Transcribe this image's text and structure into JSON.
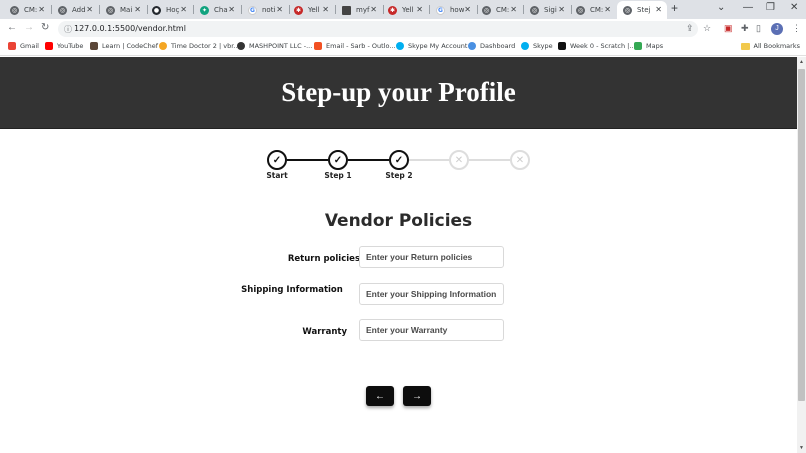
{
  "browser": {
    "tabs": [
      {
        "title": "CM:",
        "icon": "globe-icon"
      },
      {
        "title": "Add",
        "icon": "globe-icon"
      },
      {
        "title": "Mai",
        "icon": "globe-icon"
      },
      {
        "title": "Hoç",
        "icon": "github-icon"
      },
      {
        "title": "Cha",
        "icon": "chatgpt-icon"
      },
      {
        "title": "noti",
        "icon": "google-icon"
      },
      {
        "title": "Yell",
        "icon": "yelp-icon"
      },
      {
        "title": "myf",
        "icon": "page-icon"
      },
      {
        "title": "Yell",
        "icon": "yelp-icon"
      },
      {
        "title": "how",
        "icon": "google-icon"
      },
      {
        "title": "CM:",
        "icon": "globe-icon"
      },
      {
        "title": "Sigi",
        "icon": "globe-icon"
      },
      {
        "title": "CM:",
        "icon": "globe-icon"
      },
      {
        "title": "Stej",
        "icon": "globe-icon",
        "active": true
      }
    ],
    "url": "127.0.0.1:5500/vendor.html",
    "profile_initial": "J",
    "bookmarks": [
      {
        "label": "Gmail",
        "color": "#ea4335"
      },
      {
        "label": "YouTube",
        "color": "#ff0000"
      },
      {
        "label": "Learn | CodeChef",
        "color": "#5b4638"
      },
      {
        "label": "Time Doctor 2 | vbr...",
        "color": "#f4a623"
      },
      {
        "label": "MASHPOINT LLC -...",
        "color": "#333333"
      },
      {
        "label": "Email - Sarb - Outlo...",
        "color": "#f25022"
      },
      {
        "label": "Skype My Account",
        "color": "#00aff0"
      },
      {
        "label": "Dashboard",
        "color": "#4a90e2"
      },
      {
        "label": "Skype",
        "color": "#00aff0"
      },
      {
        "label": "Week 0 - Scratch |...",
        "color": "#111111"
      },
      {
        "label": "Maps",
        "color": "#34a853"
      }
    ],
    "all_bookmarks": "All Bookmarks"
  },
  "page": {
    "header_title": "Step-up your Profile",
    "steps": [
      {
        "label": "Start",
        "status": "done"
      },
      {
        "label": "Step 1",
        "status": "done"
      },
      {
        "label": "Step 2",
        "status": "done"
      },
      {
        "label": "",
        "status": "todo"
      },
      {
        "label": "",
        "status": "todo"
      }
    ],
    "form_title": "Vendor Policies",
    "fields": [
      {
        "label": "Return policies",
        "placeholder": "Enter your Return policies"
      },
      {
        "label": "Shipping Information",
        "placeholder": "Enter your Shipping Information"
      },
      {
        "label": "Warranty",
        "placeholder": "Enter your Warranty"
      }
    ],
    "prev_button": "←",
    "next_button": "→"
  }
}
